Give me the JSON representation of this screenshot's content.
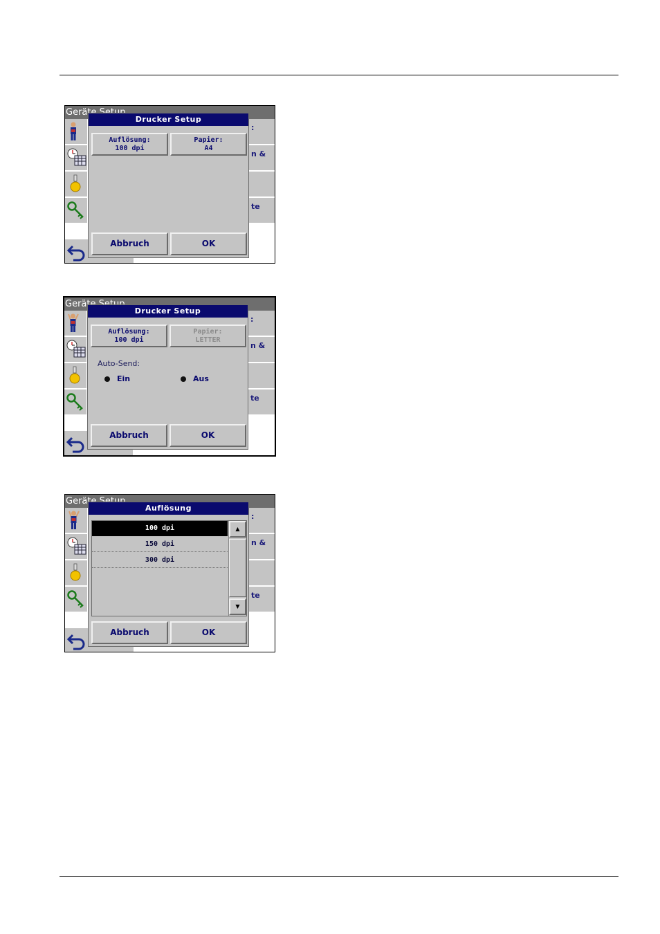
{
  "background": {
    "title": "Geräte Setup",
    "right_labels": [
      ":",
      "n &",
      "",
      "te"
    ]
  },
  "screens": [
    {
      "dialog_title": "Drucker Setup",
      "resolution_btn": {
        "line1": "Auflösung:",
        "line2": "100 dpi"
      },
      "paper_btn": {
        "line1": "Papier:",
        "line2": "A4"
      },
      "cancel": "Abbruch",
      "ok": "OK"
    },
    {
      "dialog_title": "Drucker Setup",
      "resolution_btn": {
        "line1": "Auflösung:",
        "line2": "100 dpi"
      },
      "paper_btn": {
        "line1": "Papier:",
        "line2": "LETTER"
      },
      "autosend_label": "Auto-Send:",
      "radio_on": "Ein",
      "radio_off": "Aus",
      "cancel": "Abbruch",
      "ok": "OK"
    },
    {
      "dialog_title": "Auflösung",
      "options": [
        "100 dpi",
        "150 dpi",
        "300 dpi"
      ],
      "selected_index": 0,
      "cancel": "Abbruch",
      "ok": "OK"
    }
  ],
  "colors": {
    "dialog_title_bg": "#0a0a6e",
    "panel_gray": "#c4c4c4",
    "header_gray": "#6e6e6e",
    "text_blue": "#0a0a6e"
  },
  "icons": [
    "user-icon",
    "clock-calendar-icon",
    "lamp-icon",
    "key-icon",
    "back-arrow-icon"
  ]
}
